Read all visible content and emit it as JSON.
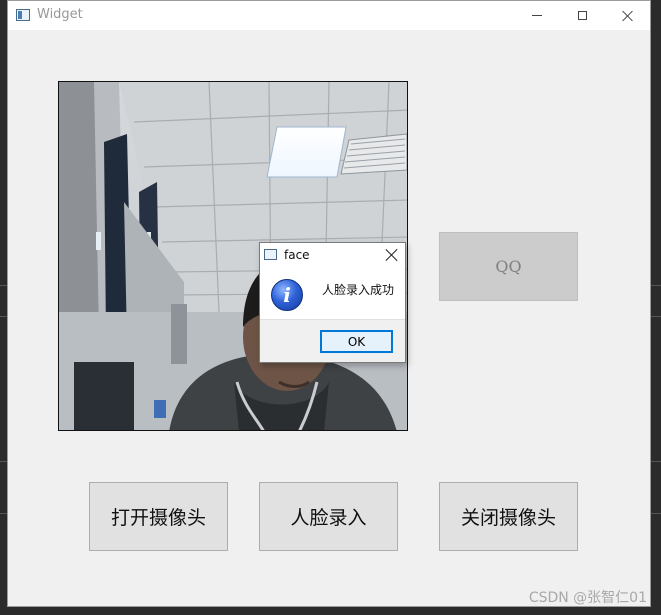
{
  "window": {
    "title": "Widget"
  },
  "widget": {
    "qq_button": "QQ",
    "open_camera_button": "打开摄像头",
    "face_enroll_button": "人脸录入",
    "close_camera_button": "关闭摄像头"
  },
  "dialog": {
    "title": "face",
    "message": "人脸录入成功",
    "ok_button": "OK"
  },
  "watermark": "CSDN @张智仁01",
  "icons": {
    "app": "app-window-icon",
    "info": "info-icon",
    "minimize": "minimize-icon",
    "maximize": "maximize-icon",
    "close": "close-icon"
  },
  "colors": {
    "window_bg": "#f0f0f0",
    "button_bg": "#e1e1e1",
    "disabled_button_bg": "#cccccc",
    "ok_accent": "#0078d7"
  }
}
